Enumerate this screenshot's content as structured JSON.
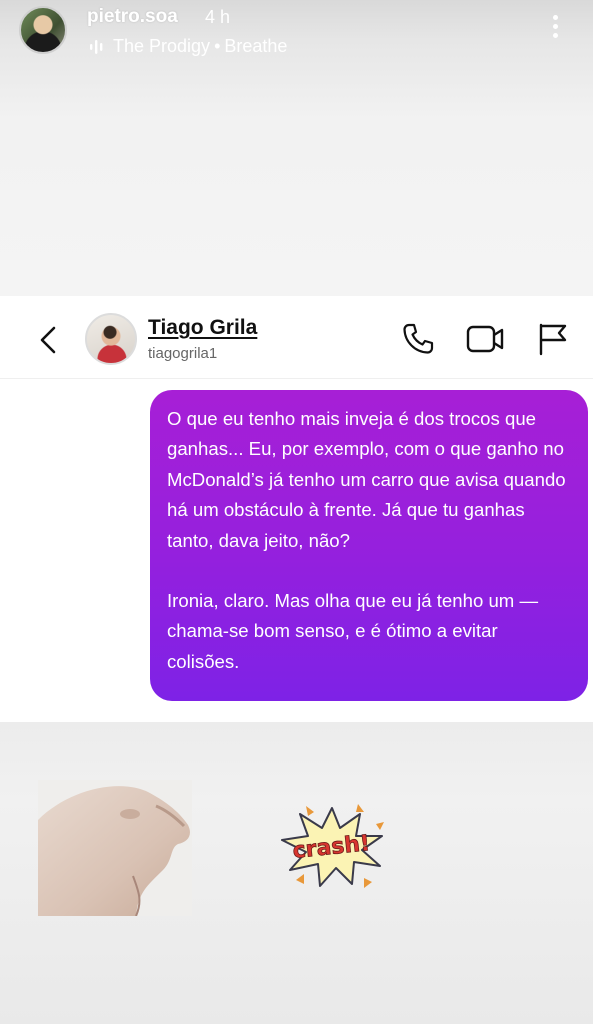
{
  "story": {
    "username": "pietro.soa",
    "time_ago": "4 h",
    "music": {
      "artist": "The Prodigy",
      "separator": "•",
      "track": "Breathe"
    }
  },
  "dm": {
    "contact_name": "Tiago Grila",
    "contact_handle": "tiagogrila1",
    "message": {
      "paragraph_1": "O que eu tenho mais inveja é dos trocos que ganhas... Eu, por exemplo, com o que ganho no McDonald’s já tenho um carro que avisa quando há um obstáculo à frente. Já que tu ganhas tanto, dava jeito, não?",
      "paragraph_2": "Ironia, claro. Mas olha que eu já tenho um — chama-se bom senso, e é ótimo a evitar colisões."
    }
  },
  "stickers": {
    "crash_text": "crash!"
  },
  "icons": [
    "music-icon",
    "more-options-icon",
    "back-arrow-icon",
    "phone-call-icon",
    "video-call-icon",
    "report-flag-icon"
  ],
  "colors": {
    "bubble_top": "#a71fd6",
    "bubble_bottom": "#7e22e6",
    "story_text": "#ffffff"
  }
}
